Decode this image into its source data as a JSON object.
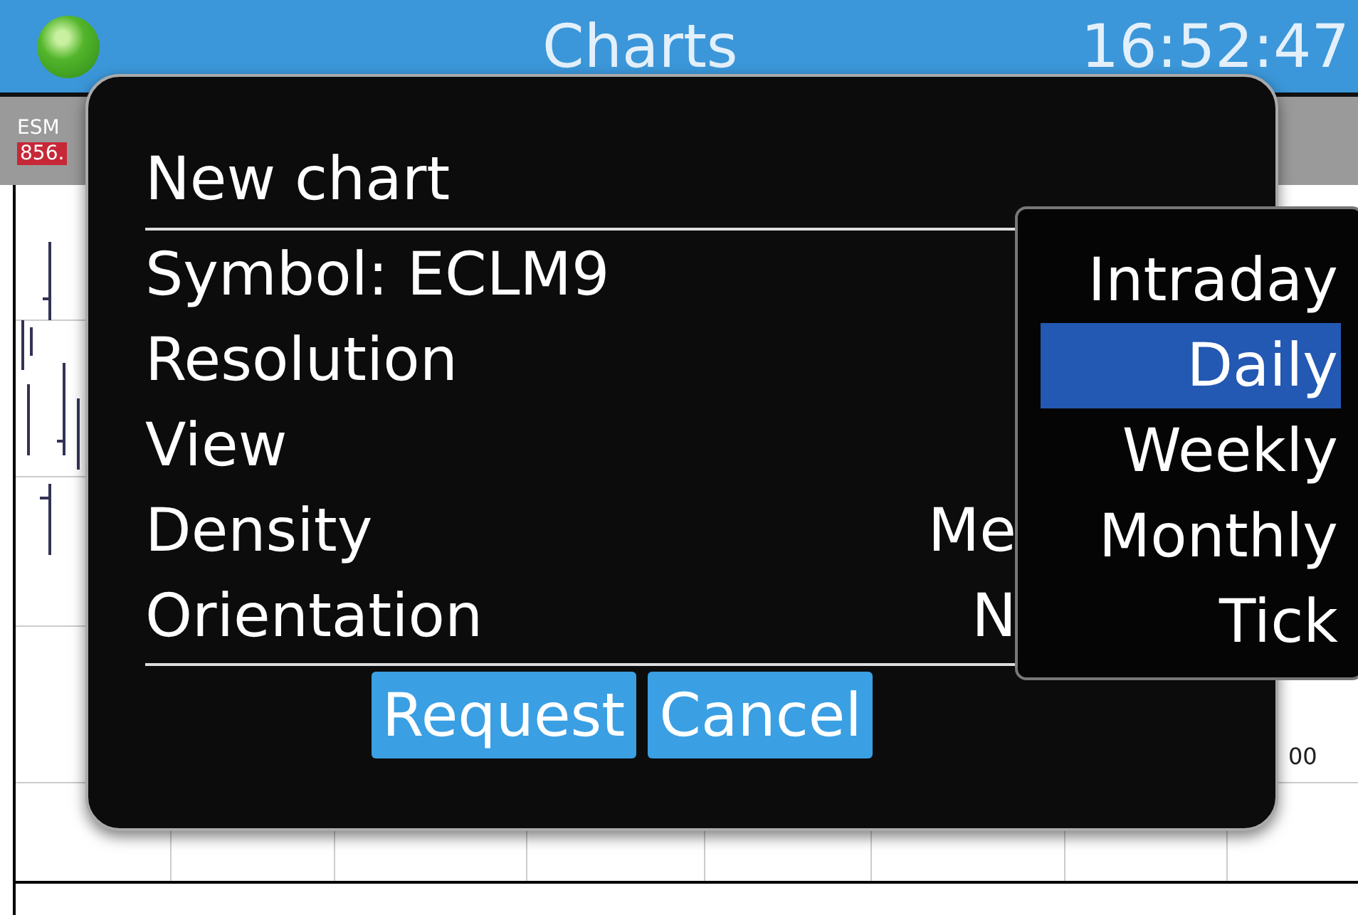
{
  "header": {
    "status_on": true,
    "title": "Charts",
    "time": "16:52:47"
  },
  "chart": {
    "symbol": "ESM",
    "price": "856.",
    "axis_label": "00"
  },
  "dialog": {
    "title": "New chart",
    "rows": [
      {
        "label": "Symbol: ECLM9"
      },
      {
        "label": "Resolution"
      },
      {
        "label": "View"
      },
      {
        "label": "Density",
        "value": "Me"
      },
      {
        "label": "Orientation",
        "value": "N"
      }
    ],
    "buttons": [
      "Request",
      "Cancel"
    ]
  },
  "dropdown": {
    "options": [
      {
        "label": "Intraday",
        "selected": false
      },
      {
        "label": "Daily",
        "selected": true
      },
      {
        "label": "Weekly",
        "selected": false
      },
      {
        "label": "Monthly",
        "selected": false
      },
      {
        "label": "Tick",
        "selected": false
      }
    ]
  }
}
